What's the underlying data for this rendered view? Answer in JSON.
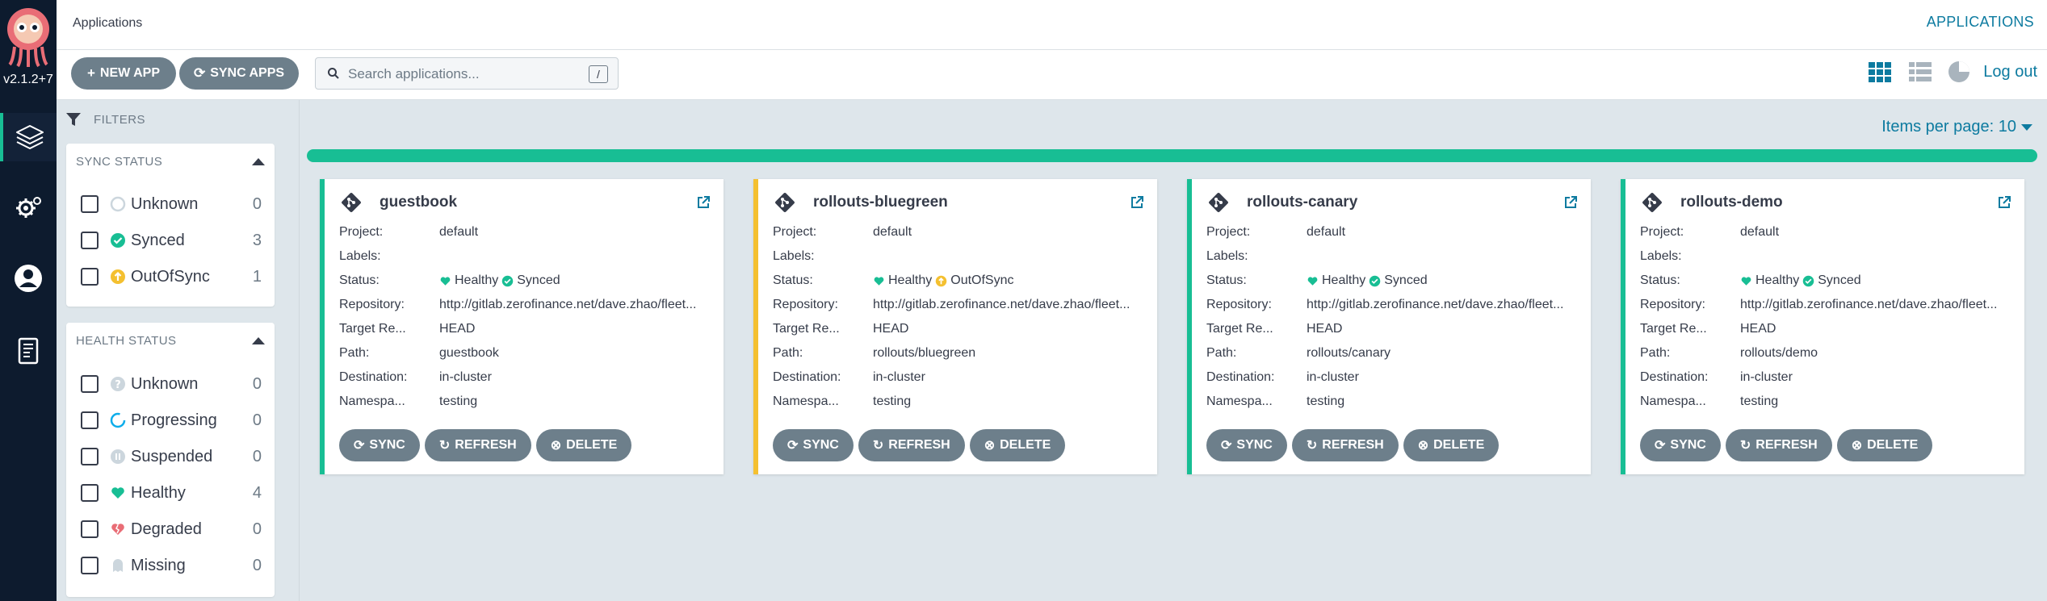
{
  "nav": {
    "version": "v2.1.2+7",
    "items": [
      {
        "name": "applications"
      },
      {
        "name": "settings"
      },
      {
        "name": "user-info"
      },
      {
        "name": "documentation"
      }
    ]
  },
  "header": {
    "breadcrumb": "Applications",
    "title": "APPLICATIONS"
  },
  "toolbar": {
    "new_app": "NEW APP",
    "sync_apps": "SYNC APPS",
    "search_placeholder": "Search applications...",
    "search_shortcut": "/",
    "logout": "Log out"
  },
  "filters": {
    "header": "FILTERS",
    "sync_status": {
      "title": "SYNC STATUS",
      "items": [
        {
          "label": "Unknown",
          "count": "0"
        },
        {
          "label": "Synced",
          "count": "3"
        },
        {
          "label": "OutOfSync",
          "count": "1"
        }
      ]
    },
    "health_status": {
      "title": "HEALTH STATUS",
      "items": [
        {
          "label": "Unknown",
          "count": "0"
        },
        {
          "label": "Progressing",
          "count": "0"
        },
        {
          "label": "Suspended",
          "count": "0"
        },
        {
          "label": "Healthy",
          "count": "4"
        },
        {
          "label": "Degraded",
          "count": "0"
        },
        {
          "label": "Missing",
          "count": "0"
        }
      ]
    }
  },
  "items_per_page": "Items per page: 10",
  "field_labels": {
    "project": "Project:",
    "labels": "Labels:",
    "status": "Status:",
    "repository": "Repository:",
    "target": "Target Re...",
    "path": "Path:",
    "destination": "Destination:",
    "namespace": "Namespa..."
  },
  "card_buttons": {
    "sync": "SYNC",
    "refresh": "REFRESH",
    "delete": "DELETE"
  },
  "apps": [
    {
      "name": "guestbook",
      "project": "default",
      "labels": "",
      "health": "Healthy",
      "sync": "Synced",
      "repository": "http://gitlab.zerofinance.net/dave.zhao/fleet...",
      "target": "HEAD",
      "path": "guestbook",
      "destination": "in-cluster",
      "namespace": "testing"
    },
    {
      "name": "rollouts-bluegreen",
      "project": "default",
      "labels": "",
      "health": "Healthy",
      "sync": "OutOfSync",
      "repository": "http://gitlab.zerofinance.net/dave.zhao/fleet...",
      "target": "HEAD",
      "path": "rollouts/bluegreen",
      "destination": "in-cluster",
      "namespace": "testing"
    },
    {
      "name": "rollouts-canary",
      "project": "default",
      "labels": "",
      "health": "Healthy",
      "sync": "Synced",
      "repository": "http://gitlab.zerofinance.net/dave.zhao/fleet...",
      "target": "HEAD",
      "path": "rollouts/canary",
      "destination": "in-cluster",
      "namespace": "testing"
    },
    {
      "name": "rollouts-demo",
      "project": "default",
      "labels": "",
      "health": "Healthy",
      "sync": "Synced",
      "repository": "http://gitlab.zerofinance.net/dave.zhao/fleet...",
      "target": "HEAD",
      "path": "rollouts/demo",
      "destination": "in-cluster",
      "namespace": "testing"
    }
  ],
  "colors": {
    "healthy": "#18be94",
    "out_of_sync": "#f4c030",
    "degraded": "#e96d76",
    "accent": "#0d7ba0",
    "nav_bg": "#0d1b2e"
  }
}
